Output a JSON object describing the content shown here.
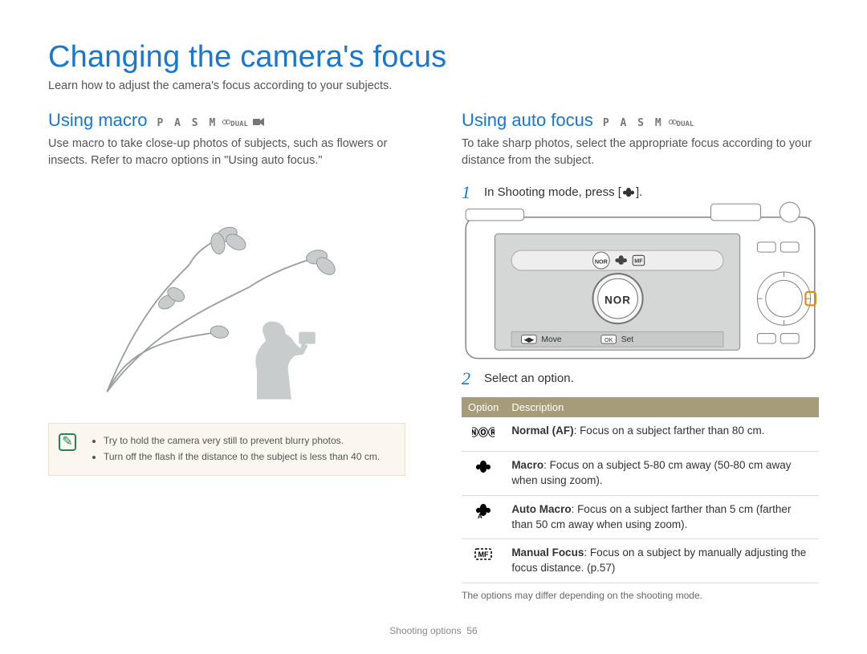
{
  "title": "Changing the camera's focus",
  "subtitle": "Learn how to adjust the camera's focus according to your subjects.",
  "footer": {
    "section": "Shooting options",
    "page": "56"
  },
  "left": {
    "heading": "Using macro",
    "modes": "P A S M",
    "modes_tiny_1": "DUAL",
    "lead": "Use macro to take close-up photos of subjects, such as flowers or insects. Refer to macro options in \"Using auto focus.\"",
    "tips": [
      "Try to hold the camera very still to prevent blurry photos.",
      "Turn off the flash if the distance to the subject is less than 40 cm."
    ]
  },
  "right": {
    "heading": "Using auto focus",
    "modes": "P A S M",
    "modes_tiny_1": "DUAL",
    "lead": "To take sharp photos, select the appropriate focus according to your distance from the subject.",
    "step1_num": "1",
    "step1_text": "In Shooting mode, press [",
    "step1_text_after": "].",
    "step2_num": "2",
    "step2_text": "Select an option.",
    "camera_overlay": {
      "move": "Move",
      "set": "Set",
      "nor": "NOR",
      "ok": "OK"
    },
    "table": {
      "cols": [
        "Option",
        "Description"
      ],
      "rows": [
        {
          "icon_label": "nor",
          "name": "Normal (AF)",
          "desc": ": Focus on a subject farther than 80 cm."
        },
        {
          "icon_label": "macro",
          "name": "Macro",
          "desc": ": Focus on a subject 5-80 cm away (50-80 cm away when using zoom)."
        },
        {
          "icon_label": "auto-macro",
          "name": "Auto Macro",
          "desc": ": Focus on a subject farther than 5 cm (farther than 50 cm away when using zoom)."
        },
        {
          "icon_label": "mf",
          "name": "Manual Focus",
          "desc": ": Focus on a subject by manually adjusting the focus distance. (p.57)"
        }
      ]
    },
    "footnote": "The options may differ depending on the shooting mode."
  }
}
